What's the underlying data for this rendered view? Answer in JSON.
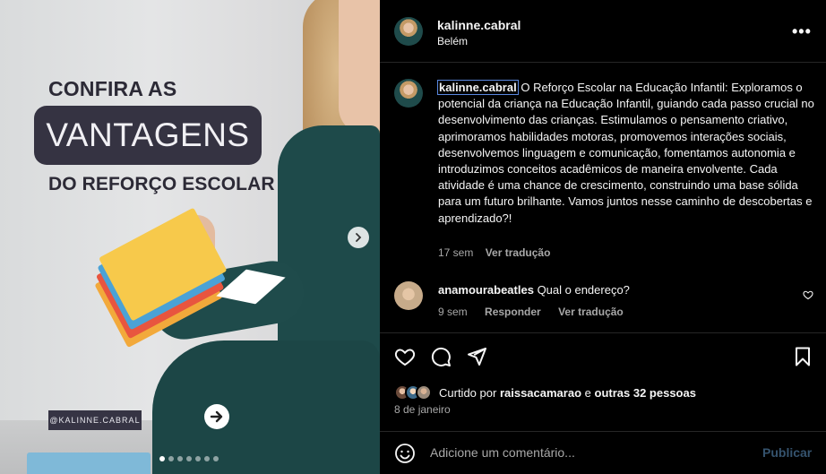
{
  "media": {
    "title_line1": "CONFIRA AS",
    "title_highlight": "VANTAGENS",
    "title_line3": "DO REFORÇO ESCOLAR",
    "handle_tag": "@KALINNE.CABRAL",
    "carousel_dots": 7,
    "carousel_active_index": 0
  },
  "header": {
    "username": "kalinne.cabral",
    "location": "Belém",
    "more_label": "•••"
  },
  "caption": {
    "username": "kalinne.cabral",
    "text": "O Reforço Escolar na Educação Infantil: Exploramos o potencial da criança na Educação Infantil, guiando cada passo crucial no desenvolvimento das crianças. Estimulamos o pensamento criativo, aprimoramos habilidades motoras, promovemos interações sociais, desenvolvemos linguagem e comunicação, fomentamos autonomia e introduzimos conceitos acadêmicos de maneira envolvente. Cada atividade é uma chance de crescimento, construindo uma base sólida para um futuro brilhante. Vamos juntos nesse caminho de descobertas e aprendizado?!",
    "time": "17 sem",
    "translate": "Ver tradução"
  },
  "comment": {
    "username": "anamourabeatles",
    "text": "Qual o endereço?",
    "time": "9 sem",
    "reply": "Responder",
    "translate": "Ver tradução"
  },
  "likes": {
    "prefix": "Curtido por",
    "user": "raissacamarao",
    "connector": "e",
    "others": "outras 32 pessoas"
  },
  "date": "8 de janeiro",
  "add_comment": {
    "placeholder": "Adicione um comentário...",
    "publish": "Publicar"
  },
  "colors": {
    "background": "#000000",
    "text": "#f5f5f5",
    "secondary": "#a8a8a8",
    "publish_disabled": "#35536e",
    "uniform": "#1e4a4a",
    "pill": "#353342"
  }
}
